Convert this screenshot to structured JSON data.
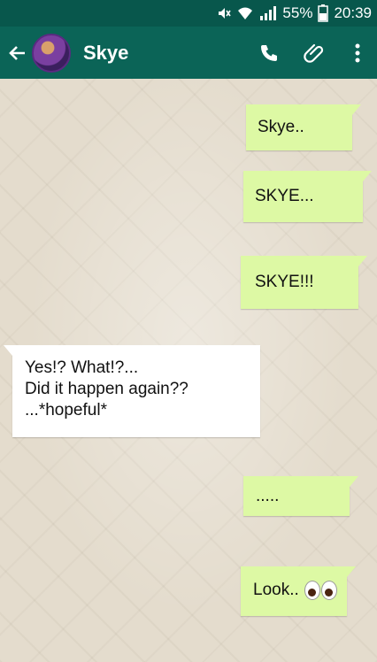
{
  "status_bar": {
    "battery": "55%",
    "time": "20:39"
  },
  "header": {
    "contact_name": "Skye"
  },
  "messages": [
    {
      "text": "Skye..",
      "direction": "outgoing"
    },
    {
      "text": "SKYE...",
      "direction": "outgoing"
    },
    {
      "text": "SKYE!!!",
      "direction": "outgoing"
    },
    {
      "text": "Yes!? What!?...\nDid it happen again??\n...*hopeful*",
      "direction": "incoming"
    },
    {
      "text": ".....",
      "direction": "outgoing"
    },
    {
      "text": "Look..",
      "direction": "outgoing",
      "emoji": "eyes-emoji"
    }
  ],
  "colors": {
    "status_bar": "#08574c",
    "app_bar": "#0b6457",
    "outgoing_bubble": "#ddf9a4",
    "incoming_bubble": "#ffffff",
    "chat_background": "#e4dccd"
  }
}
